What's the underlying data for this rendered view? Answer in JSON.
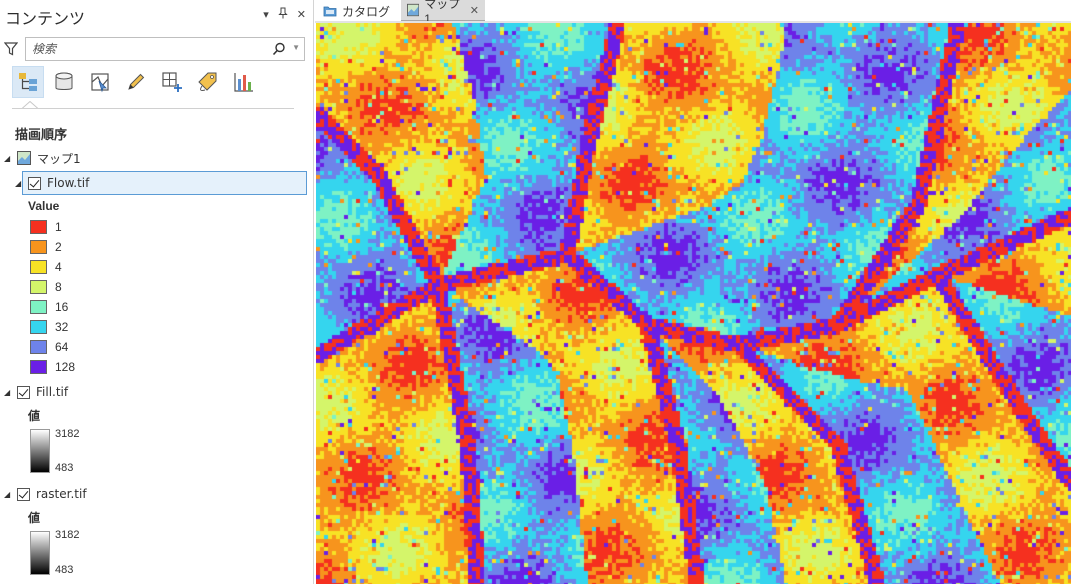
{
  "contents_pane": {
    "title": "コンテンツ",
    "controls": {
      "menu": "▾",
      "pin": "ᵖ",
      "close": "✕"
    },
    "search": {
      "placeholder": "検索",
      "value": ""
    },
    "toolbar": [
      {
        "name": "list-by-drawing-order-button",
        "icon": "drawing-order-icon",
        "active": true
      },
      {
        "name": "list-by-data-source-button",
        "icon": "database-icon",
        "active": false
      },
      {
        "name": "list-by-selection-button",
        "icon": "selection-icon",
        "active": false
      },
      {
        "name": "list-by-editing-button",
        "icon": "pencil-icon",
        "active": false
      },
      {
        "name": "list-by-snapping-button",
        "icon": "snapping-icon",
        "active": false
      },
      {
        "name": "list-by-labeling-button",
        "icon": "label-icon",
        "active": false
      },
      {
        "name": "list-by-charts-button",
        "icon": "chart-icon",
        "active": false
      }
    ],
    "section_title": "描画順序",
    "map_name": "マップ1",
    "layers": [
      {
        "name": "Flow.tif",
        "checked": true,
        "legend_heading": "Value",
        "classes": [
          {
            "label": "1",
            "color": "#f5301f"
          },
          {
            "label": "2",
            "color": "#f7941d"
          },
          {
            "label": "4",
            "color": "#f7e225"
          },
          {
            "label": "8",
            "color": "#d4f56a"
          },
          {
            "label": "16",
            "color": "#7ef2c4"
          },
          {
            "label": "32",
            "color": "#35d5ee"
          },
          {
            "label": "64",
            "color": "#6e83ea"
          },
          {
            "label": "128",
            "color": "#6a1fe6"
          }
        ]
      },
      {
        "name": "Fill.tif",
        "checked": true,
        "legend_heading": "値",
        "high": "3182",
        "low": "483"
      },
      {
        "name": "raster.tif",
        "checked": true,
        "legend_heading": "値",
        "high": "3182",
        "low": "483"
      }
    ]
  },
  "tabs": [
    {
      "label": "カタログ",
      "icon": "catalog-folder-icon",
      "active": false
    },
    {
      "label": "マップ1",
      "icon": "map-icon",
      "active": true,
      "close": "✕"
    }
  ]
}
